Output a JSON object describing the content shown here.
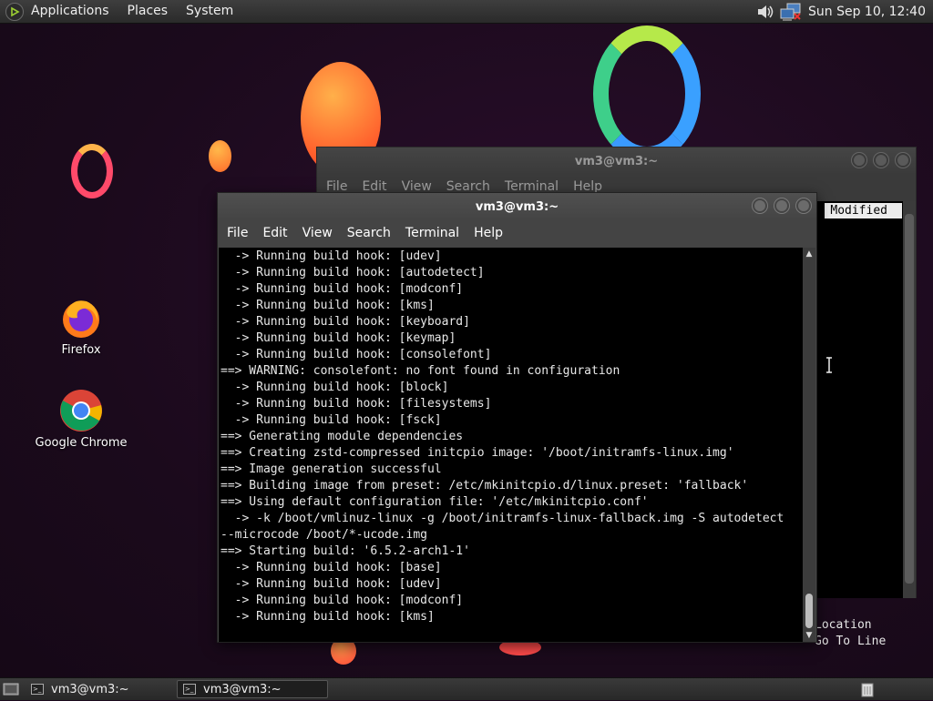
{
  "top_panel": {
    "menus": [
      "Applications",
      "Places",
      "System"
    ],
    "clock": "Sun Sep 10, 12:40",
    "icons": [
      "distro-logo-icon",
      "volume-icon",
      "network-icon"
    ]
  },
  "desktop_icons": [
    {
      "label": "Firefox",
      "icon": "firefox-icon"
    },
    {
      "label": "Google Chrome",
      "icon": "chrome-icon"
    }
  ],
  "back_window": {
    "title": "vm3@vm3:~",
    "menus": [
      "File",
      "Edit",
      "View",
      "Search",
      "Terminal",
      "Help"
    ],
    "nano_modified": "Modified",
    "nano_footer": [
      "Location",
      "Go To Line"
    ]
  },
  "front_window": {
    "title": "vm3@vm3:~",
    "menus": [
      "File",
      "Edit",
      "View",
      "Search",
      "Terminal",
      "Help"
    ],
    "lines": [
      "  -> Running build hook: [udev]",
      "  -> Running build hook: [autodetect]",
      "  -> Running build hook: [modconf]",
      "  -> Running build hook: [kms]",
      "  -> Running build hook: [keyboard]",
      "  -> Running build hook: [keymap]",
      "  -> Running build hook: [consolefont]",
      "==> WARNING: consolefont: no font found in configuration",
      "  -> Running build hook: [block]",
      "  -> Running build hook: [filesystems]",
      "  -> Running build hook: [fsck]",
      "==> Generating module dependencies",
      "==> Creating zstd-compressed initcpio image: '/boot/initramfs-linux.img'",
      "==> Image generation successful",
      "==> Building image from preset: /etc/mkinitcpio.d/linux.preset: 'fallback'",
      "==> Using default configuration file: '/etc/mkinitcpio.conf'",
      "  -> -k /boot/vmlinuz-linux -g /boot/initramfs-linux-fallback.img -S autodetect",
      "--microcode /boot/*-ucode.img",
      "==> Starting build: '6.5.2-arch1-1'",
      "  -> Running build hook: [base]",
      "  -> Running build hook: [udev]",
      "  -> Running build hook: [modconf]",
      "  -> Running build hook: [kms]"
    ]
  },
  "taskbar": {
    "tasks": [
      {
        "label": "vm3@vm3:~",
        "active": false
      },
      {
        "label": "vm3@vm3:~",
        "active": true
      }
    ]
  }
}
